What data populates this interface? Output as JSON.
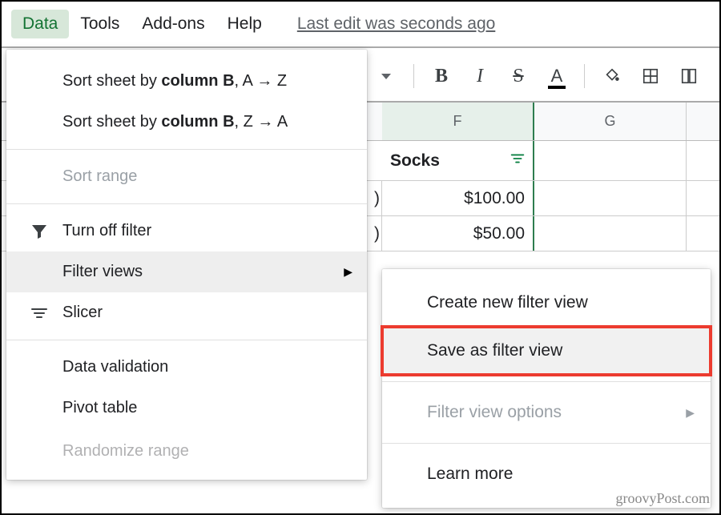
{
  "menubar": {
    "items": [
      "Data",
      "Tools",
      "Add-ons",
      "Help"
    ],
    "active_index": 0,
    "edit_status": "Last edit was seconds ago"
  },
  "toolbar": {
    "bold": "B",
    "italic": "I",
    "strike": "S",
    "textcolor": "A"
  },
  "grid": {
    "col_headers": {
      "F": "F",
      "G": "G"
    },
    "rows": [
      {
        "E_partial": "",
        "F": "Socks",
        "F_is_header": true,
        "G": ""
      },
      {
        "E_partial": ")",
        "F": "$100.00",
        "G": ""
      },
      {
        "E_partial": ")",
        "F": "$50.00",
        "G": ""
      }
    ]
  },
  "data_menu": {
    "sort_az_prefix": "Sort sheet by ",
    "sort_az_bold": "column B",
    "sort_az_suffix": ", A → Z",
    "sort_za_prefix": "Sort sheet by ",
    "sort_za_bold": "column B",
    "sort_za_suffix": ", Z → A",
    "sort_range": "Sort range",
    "turn_off_filter": "Turn off filter",
    "filter_views": "Filter views",
    "slicer": "Slicer",
    "data_validation": "Data validation",
    "pivot_table": "Pivot table",
    "randomize_range": "Randomize range"
  },
  "filter_views_submenu": {
    "create": "Create new filter view",
    "save": "Save as filter view",
    "options": "Filter view options",
    "learn": "Learn more"
  },
  "watermark": "groovyPost.com"
}
